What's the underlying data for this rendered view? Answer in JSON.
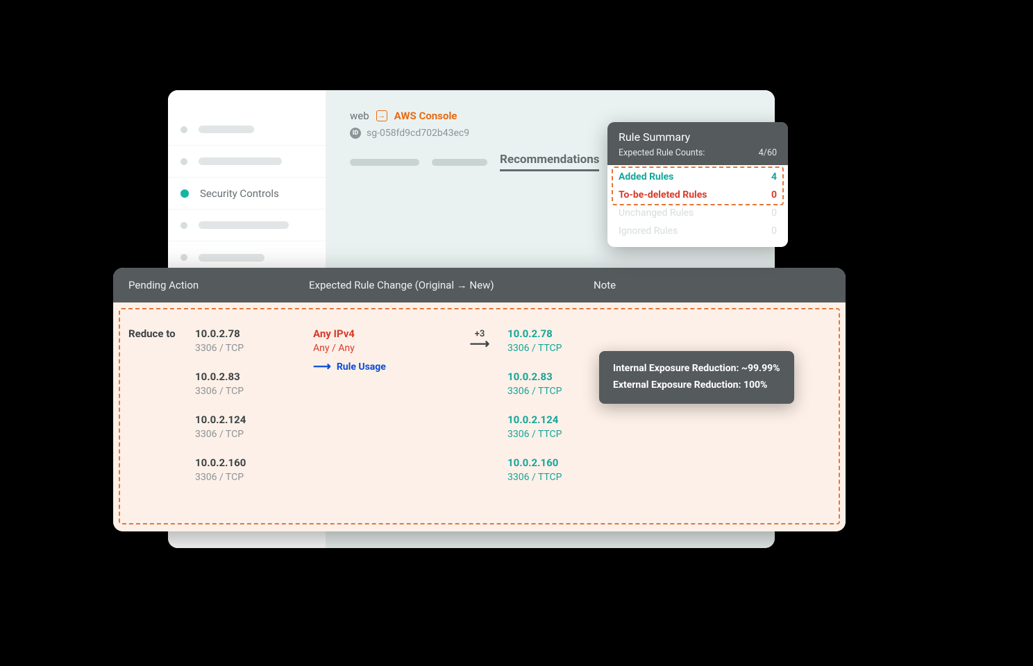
{
  "sidebar": {
    "active_label": "Security Controls"
  },
  "header": {
    "web_label": "web",
    "aws_link": "AWS Console",
    "id_label": "ID",
    "resource_id": "sg-058fd9cd702b43ec9",
    "tab_active": "Recommendations"
  },
  "summary": {
    "title": "Rule Summary",
    "sub_label": "Expected Rule Counts:",
    "sub_value": "4/60",
    "rows": {
      "added_label": "Added Rules",
      "added_value": "4",
      "deleted_label": "To-be-deleted Rules",
      "deleted_value": "0",
      "unchanged_label": "Unchanged Rules",
      "unchanged_value": "0",
      "ignored_label": "Ignored Rules",
      "ignored_value": "0"
    }
  },
  "table": {
    "headers": {
      "pending": "Pending Action",
      "change": "Expected Rule Change (Original → New)",
      "note": "Note"
    },
    "pending_label": "Reduce to",
    "original": {
      "line1": "Any IPv4",
      "line2": "Any / Any",
      "plus": "+3"
    },
    "rule_usage_label": "Rule Usage",
    "rows": [
      {
        "ip": "10.0.2.78",
        "orig": "3306 / TCP",
        "new_ip": "10.0.2.78",
        "new_proto": "3306 / TTCP"
      },
      {
        "ip": "10.0.2.83",
        "orig": "3306 / TCP",
        "new_ip": "10.0.2.83",
        "new_proto": "3306 / TTCP"
      },
      {
        "ip": "10.0.2.124",
        "orig": "3306 / TCP",
        "new_ip": "10.0.2.124",
        "new_proto": "3306 / TTCP"
      },
      {
        "ip": "10.0.2.160",
        "orig": "3306 / TCP",
        "new_ip": "10.0.2.160",
        "new_proto": "3306 / TTCP"
      }
    ],
    "note_tip": {
      "line1": "Internal Exposure Reduction: ~99.99%",
      "line2": "External Exposure Reduction: 100%"
    }
  }
}
